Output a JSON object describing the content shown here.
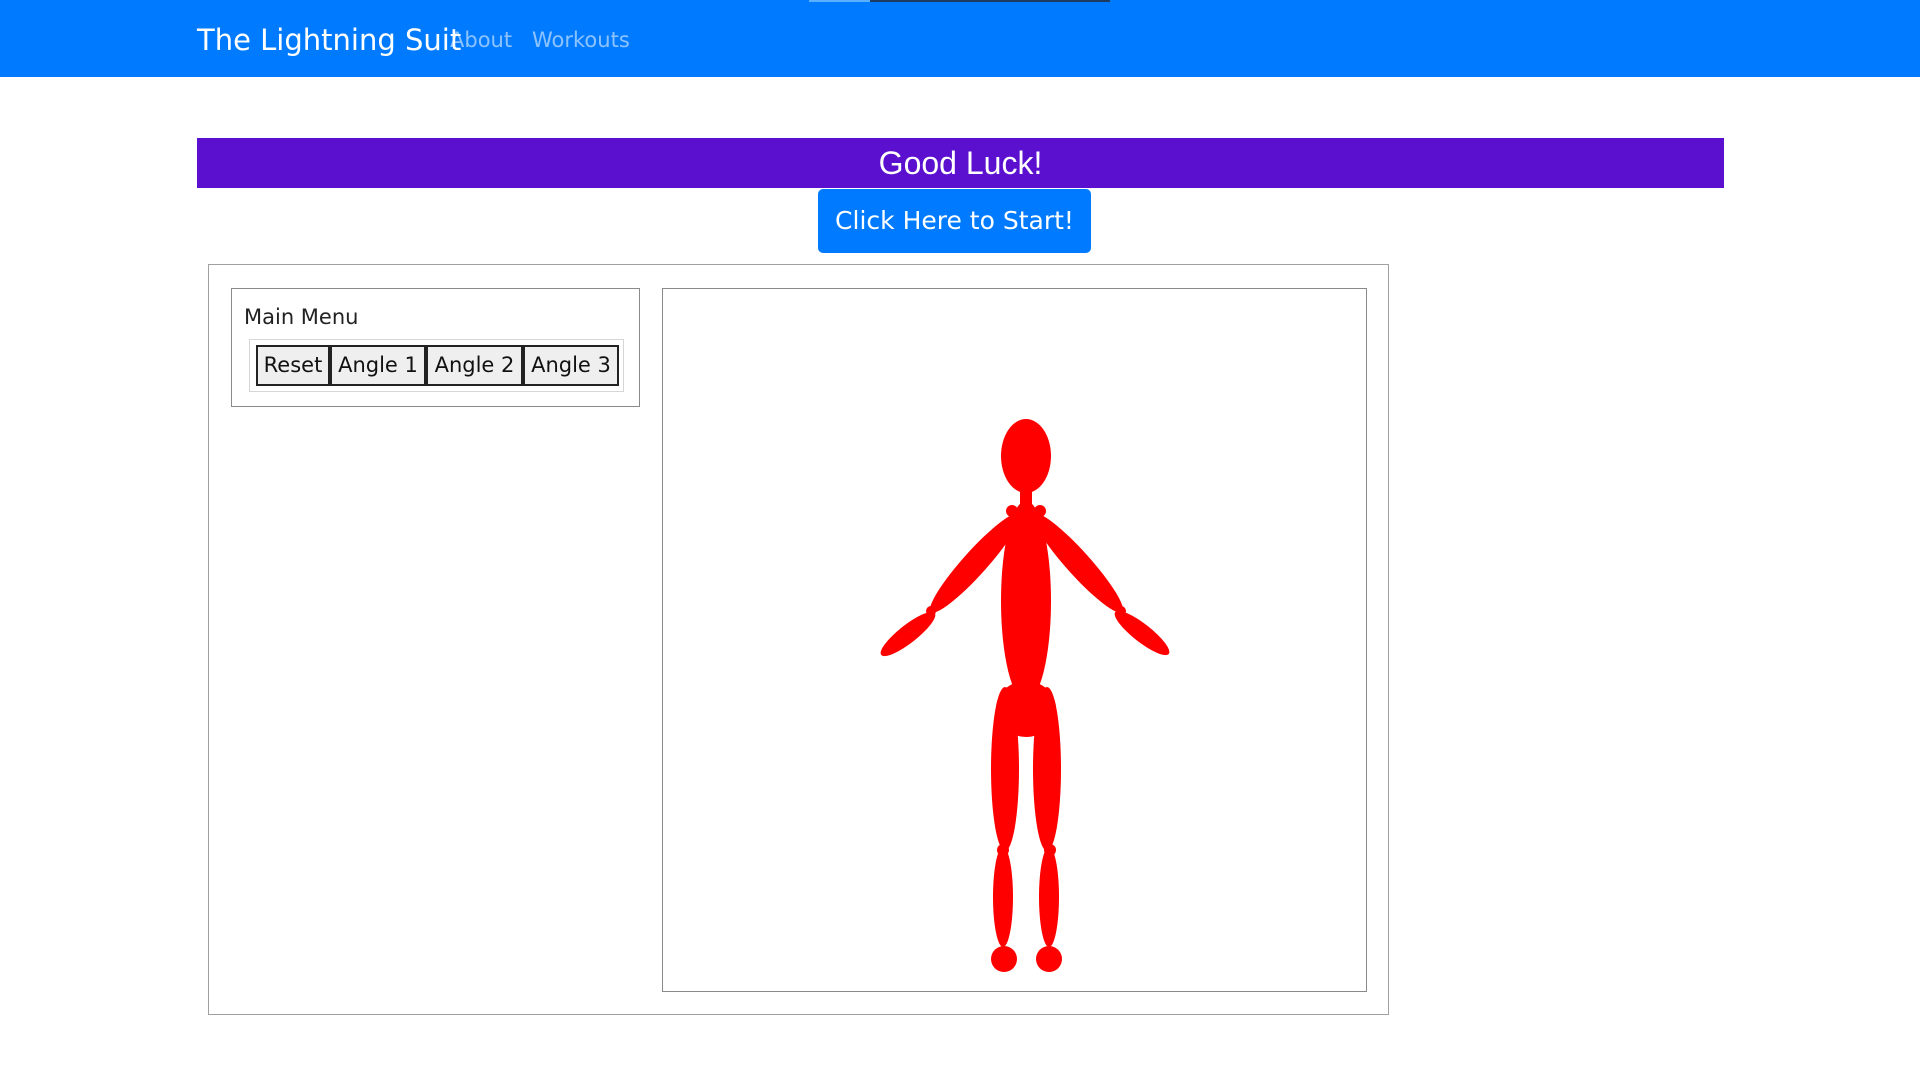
{
  "navbar": {
    "brand": "The Lightning Suit",
    "links": [
      {
        "label": "About"
      },
      {
        "label": "Workouts"
      }
    ],
    "background_color": "#007bff"
  },
  "banner": {
    "text": "Good Luck!",
    "background_color": "#5b10cf"
  },
  "start_button": {
    "label": "Click Here to Start!"
  },
  "menu": {
    "title": "Main Menu",
    "buttons": [
      {
        "label": "Reset"
      },
      {
        "label": "Angle 1"
      },
      {
        "label": "Angle 2"
      },
      {
        "label": "Angle 3"
      }
    ]
  },
  "figure": {
    "color": "#ff0000"
  }
}
